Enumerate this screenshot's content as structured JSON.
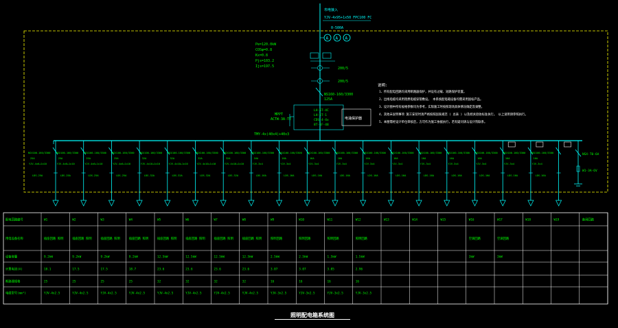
{
  "colors": {
    "background": "#000000",
    "bus": "#00ffff",
    "frame": "#ffff00",
    "label": "#00ff00",
    "note": "#ffffff",
    "table_text": "#00ff00"
  },
  "incoming": {
    "line1": "市电接入",
    "line2": "YJV-4x95+1x50  FPC100  FC",
    "line3": "0-500A",
    "params": [
      "Pe=120.0kW",
      "COSφ=0.8",
      "Kx=0.8",
      "Pjs=103.2",
      "Ijs=197.5"
    ],
    "breaker": "NS160-160/3300",
    "breaker_rating": "125A",
    "mppt": "MPPT",
    "mppt_model": "ACTW-3A-TE",
    "bus_cable": "TMY-4x(40x4)+40x3",
    "surge_box": [
      "LH-5T-4C",
      "LH-5T-1",
      "CDS-4-4x",
      "8T-1F-48"
    ],
    "surge_label": "电涌保护器",
    "meters": [
      "A",
      "A",
      "A"
    ],
    "ct": [
      "200/5",
      "200/5"
    ]
  },
  "notes": {
    "title": "说明:",
    "items": [
      "1、所有配电回路均采用断路器保护，并设有过载、短路保护装置。",
      "2、出线电缆均采用阻燃电缆穿管敷设。     本系统配电箱设备均需采用国标产品。",
      "3、设计图中所有规格参数均为参考，实际施工时按照现场具体情况确定及调整。",
      "4、其他未说明事项          施工安装时须严格按照国家规范  (  总表  )  以及相关验收标准执行。         以上说明请参照执行。",
      "5、本图需经设计单位审核后，方可作为施工依据执行，若有疑问请与设计院联系。"
    ]
  },
  "feeders": [
    {
      "breaker": "NSX100-160/3300",
      "rating": "25A",
      "cable": "YJV-4x6+1x10",
      "device": "LDS-25A",
      "icon": false
    },
    {
      "breaker": "NSX100-160/3300",
      "rating": "25A",
      "cable": "YJV-4x6+1x10",
      "device": "LDS-25A",
      "icon": false
    },
    {
      "breaker": "NSX100-160/3300",
      "rating": "25A",
      "cable": "YJV-4x6+1x10",
      "device": "LDS-25A",
      "icon": false
    },
    {
      "breaker": "NSX100-160/3300",
      "rating": "25A",
      "cable": "YJV-4x6+1x10",
      "device": "LDS-25A",
      "icon": false
    },
    {
      "breaker": "NSX100-160/3300",
      "rating": "32A",
      "cable": "YJV-4x10+1x10",
      "device": "LDS-32A",
      "icon": false
    },
    {
      "breaker": "NSX100-160/3300",
      "rating": "32A",
      "cable": "YJV-4x10+1x10",
      "device": "LDS-32A",
      "icon": false
    },
    {
      "breaker": "NSX100-160/3300",
      "rating": "32A",
      "cable": "YJV-4x10+1x10",
      "device": "LDS-32A",
      "icon": false
    },
    {
      "breaker": "NSX100-160/3300",
      "rating": "32A",
      "cable": "YJV-4x10+1x10",
      "device": "LDS-32A",
      "icon": false
    },
    {
      "breaker": "NSX100-160/3300",
      "rating": "16A",
      "cable": "YJV-3x4",
      "device": "LDS-16A",
      "icon": false
    },
    {
      "breaker": "NSX100-160/3300",
      "rating": "16A",
      "cable": "YJV-3x4",
      "device": "LDS-16A",
      "icon": false
    },
    {
      "breaker": "NSX100-160/3300",
      "rating": "16A",
      "cable": "YJV-3x4",
      "device": "LDS-16A",
      "icon": false
    },
    {
      "breaker": "NSX100-160/3300",
      "rating": "16A",
      "cable": "YJV-3x4",
      "device": "LDS-16A",
      "icon": false
    },
    {
      "breaker": "NSX100-160/3300",
      "rating": "16A",
      "cable": "YJV-3x4",
      "device": "LDS-16A",
      "icon": false
    },
    {
      "breaker": "NSX100-160/3300",
      "rating": "16A",
      "cable": "YJV-3x4",
      "device": "LDS-16A",
      "icon": false
    },
    {
      "breaker": "NSX100-160/3300",
      "rating": "16A",
      "cable": "YJV-3x4",
      "device": "LDS-16A",
      "icon": false
    },
    {
      "breaker": "NSX100-160/3300",
      "rating": "16A",
      "cable": "YJV-3x4",
      "device": "LDS-16A",
      "icon": false
    },
    {
      "breaker": "NSX100-160/3300",
      "rating": "16A",
      "cable": "YJV-3x4",
      "device": "LDS-16A",
      "icon": true
    },
    {
      "breaker": "NSX100-160/3300",
      "rating": "16A",
      "cable": "YJV-3x4",
      "device": "LDS-16A",
      "icon": true
    },
    {
      "breaker": "NSX100-160/3300",
      "rating": "16A",
      "cable": "YJV-3x4",
      "device": "LDS-16A",
      "icon": true
    }
  ],
  "spare": {
    "line1": "NSX-T0-6A",
    "line2": "W1-3A-6V"
  },
  "table": {
    "row_labels": [
      "配电回路编号",
      "用电设备名称",
      "设备容量",
      "计算电流(A)",
      "断路器规格",
      "电缆型号(mm²)"
    ],
    "col_ids": [
      "W1",
      "W2",
      "W3",
      "W4",
      "W5",
      "W6",
      "W7",
      "W8",
      "W9",
      "W10",
      "W11",
      "W12",
      "W13",
      "W14",
      "W15",
      "W16",
      "W17",
      "W18",
      "W19",
      "备用回路"
    ],
    "devices": [
      [
        "插座回路 照明",
        "插座回路 照明",
        "插座回路 照明",
        "插座回路 照明",
        "插座回路 照明",
        "插座回路 照明",
        "插座回路 照明",
        "插座回路 照明",
        "照明回路",
        "照明回路",
        "照明回路",
        "照明回路",
        "",
        "",
        "",
        "空调回路",
        "空调回路",
        "",
        "",
        ""
      ]
    ],
    "capacity": [
      "9.2kW",
      "9.2kW",
      "9.2kW",
      "9.2kW",
      "12.5kW",
      "12.5kW",
      "12.5kW",
      "12.5kW",
      "2.5kW",
      "2.5kW",
      "1.5kW",
      "1.5kW",
      "",
      "",
      "",
      "3kW",
      "3kW",
      "",
      "",
      ""
    ],
    "current": [
      "18.1",
      "17.5",
      "17.5",
      "18.7",
      "23.6",
      "23.6",
      "23.6",
      "23.6",
      "3.07",
      "3.07",
      "3.05",
      "2.96",
      "",
      "",
      "",
      "",
      "",
      "",
      "",
      ""
    ],
    "breaker": [
      "25",
      "25",
      "25",
      "25",
      "32",
      "32",
      "32",
      "32",
      "16",
      "16",
      "16",
      "16",
      "",
      "",
      "",
      "",
      "",
      "",
      "",
      ""
    ],
    "cable": [
      "YJV-4x2.5",
      "YJV-4x2.5",
      "YJV-4x2.5",
      "YJV-4x2.5",
      "YJV-4x2.5",
      "YJV-4x2.5",
      "YJV-4x2.5",
      "YJV-4x2.5",
      "YJV-3x2.5",
      "YJV-3x2.5",
      "YJV-3x2.5",
      "YJV-3x2.5",
      "",
      "",
      "",
      "",
      "",
      "",
      "",
      ""
    ]
  },
  "sheet_title": "照明配电箱系统图"
}
